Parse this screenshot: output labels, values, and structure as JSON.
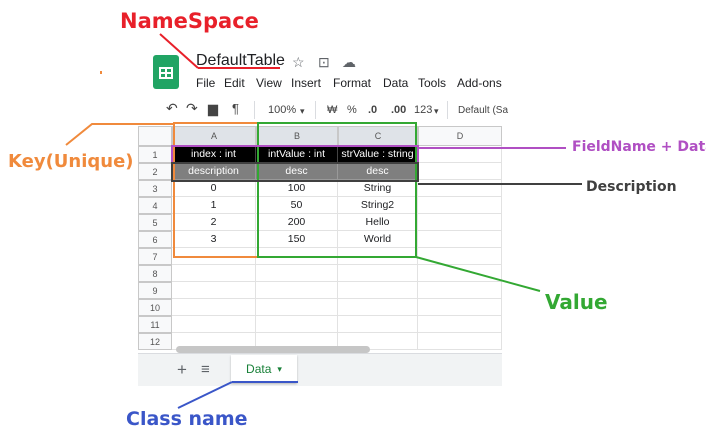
{
  "annotations": {
    "namespace": "NameSpace",
    "key": "Key(Unique)",
    "field_name_type": "FieldName + DataT",
    "description": "Description",
    "value": "Value",
    "class_name": "Class name"
  },
  "colors": {
    "namespace": "#e8202a",
    "key": "#f08a3c",
    "field_name_type": "#b04fc3",
    "description": "#404040",
    "value": "#33a833",
    "class_name": "#3a56c8"
  },
  "sheet": {
    "title": "DefaultTable",
    "menu": [
      "File",
      "Edit",
      "View",
      "Insert",
      "Format",
      "Data",
      "Tools",
      "Add-ons"
    ],
    "toolbar": {
      "zoom": "100%",
      "currency": "₩",
      "percent": "%",
      "dec_less": ".0",
      "dec_more": ".00",
      "more_formats": "123",
      "font": "Default (Sa"
    },
    "column_headers": [
      "A",
      "B",
      "C",
      "D"
    ],
    "row_numbers": [
      "1",
      "2",
      "3",
      "4",
      "5",
      "6",
      "7",
      "8",
      "9",
      "10",
      "11",
      "12"
    ],
    "rows": [
      [
        "index : int",
        "intValue : int",
        "strValue : string"
      ],
      [
        "description",
        "desc",
        "desc"
      ],
      [
        "0",
        "100",
        "String"
      ],
      [
        "1",
        "50",
        "String2"
      ],
      [
        "2",
        "200",
        "Hello"
      ],
      [
        "3",
        "150",
        "World"
      ]
    ],
    "tab_name": "Data"
  }
}
